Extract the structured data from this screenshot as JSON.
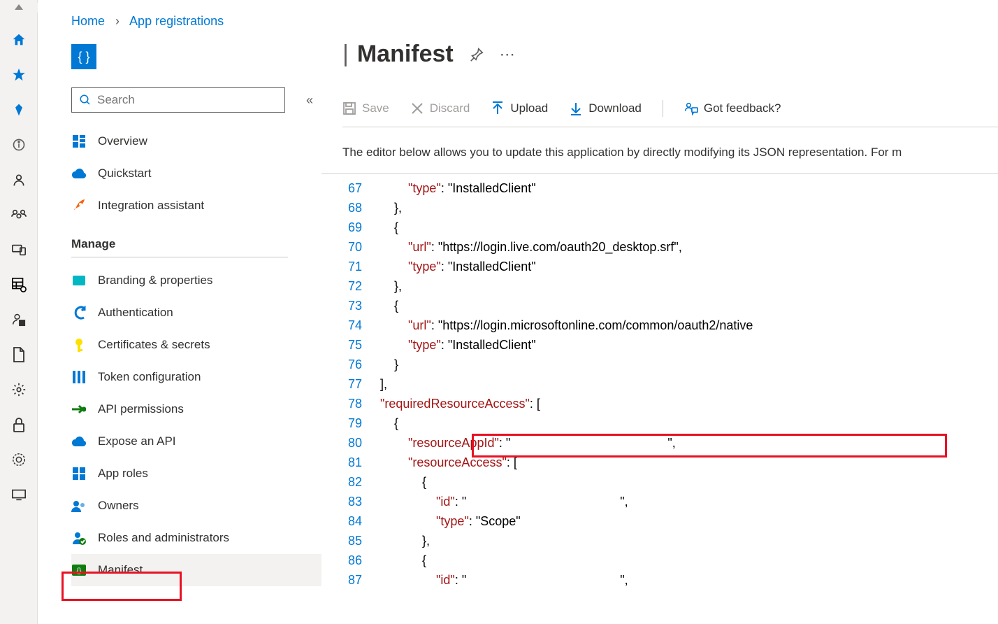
{
  "breadcrumb": {
    "home": "Home",
    "appreg": "App registrations"
  },
  "title": "Manifest",
  "search_placeholder": "Search",
  "toolbar": {
    "save": "Save",
    "discard": "Discard",
    "upload": "Upload",
    "download": "Download",
    "feedback": "Got feedback?"
  },
  "desc": "The editor below allows you to update this application by directly modifying its JSON representation. For m",
  "sidebar": {
    "overview": "Overview",
    "quickstart": "Quickstart",
    "integration": "Integration assistant",
    "manage": "Manage",
    "branding": "Branding & properties",
    "auth": "Authentication",
    "certs": "Certificates & secrets",
    "token": "Token configuration",
    "apiperm": "API permissions",
    "expose": "Expose an API",
    "approles": "App roles",
    "owners": "Owners",
    "roles": "Roles and administrators",
    "manifest": "Manifest"
  },
  "code": {
    "lines": [
      "67",
      "68",
      "69",
      "70",
      "71",
      "72",
      "73",
      "74",
      "75",
      "76",
      "77",
      "78",
      "79",
      "80",
      "81",
      "82",
      "83",
      "84",
      "85",
      "86",
      "87"
    ],
    "rows": [
      "            \"type\": \"InstalledClient\"",
      "        },",
      "        {",
      "            \"url\": \"https://login.live.com/oauth20_desktop.srf\",",
      "            \"type\": \"InstalledClient\"",
      "        },",
      "        {",
      "            \"url\": \"https://login.microsoftonline.com/common/oauth2/native",
      "            \"type\": \"InstalledClient\"",
      "        }",
      "    ],",
      "    \"requiredResourceAccess\": [",
      "        {",
      "            \"resourceAppId\": \"                                             \",",
      "            \"resourceAccess\": [",
      "                {",
      "                    \"id\": \"                                            \",",
      "                    \"type\": \"Scope\"",
      "                },",
      "                {",
      "                    \"id\": \"                                            \","
    ]
  }
}
